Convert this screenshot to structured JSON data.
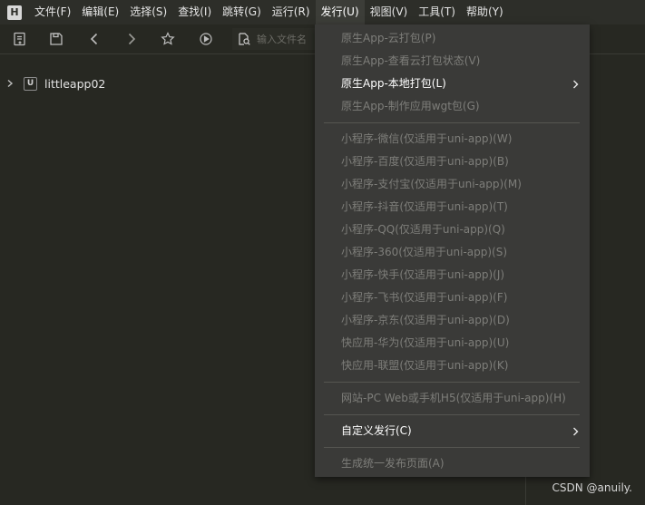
{
  "menubar": {
    "logo": "H",
    "items": [
      "文件(F)",
      "编辑(E)",
      "选择(S)",
      "查找(I)",
      "跳转(G)",
      "运行(R)",
      "发行(U)",
      "视图(V)",
      "工具(T)",
      "帮助(Y)"
    ],
    "active_index": 6
  },
  "toolbar": {
    "icons": [
      "new-file-icon",
      "save-icon",
      "back-icon",
      "forward-icon",
      "favorite-star-icon",
      "run-icon",
      "preview-icon"
    ],
    "search_placeholder": "输入文件名"
  },
  "project_tree": {
    "icon_letter": "U",
    "label": "littleapp02"
  },
  "dropdown": {
    "group1": [
      {
        "label": "原生App-云打包(P)",
        "enabled": false
      },
      {
        "label": "原生App-查看云打包状态(V)",
        "enabled": false
      },
      {
        "label": "原生App-本地打包(L)",
        "enabled": true,
        "submenu": true
      },
      {
        "label": "原生App-制作应用wgt包(G)",
        "enabled": false
      }
    ],
    "group2": [
      {
        "label": "小程序-微信(仅适用于uni-app)(W)",
        "enabled": false
      },
      {
        "label": "小程序-百度(仅适用于uni-app)(B)",
        "enabled": false
      },
      {
        "label": "小程序-支付宝(仅适用于uni-app)(M)",
        "enabled": false
      },
      {
        "label": "小程序-抖音(仅适用于uni-app)(T)",
        "enabled": false
      },
      {
        "label": "小程序-QQ(仅适用于uni-app)(Q)",
        "enabled": false
      },
      {
        "label": "小程序-360(仅适用于uni-app)(S)",
        "enabled": false
      },
      {
        "label": "小程序-快手(仅适用于uni-app)(J)",
        "enabled": false
      },
      {
        "label": "小程序-飞书(仅适用于uni-app)(F)",
        "enabled": false
      },
      {
        "label": "小程序-京东(仅适用于uni-app)(D)",
        "enabled": false
      },
      {
        "label": "快应用-华为(仅适用于uni-app)(U)",
        "enabled": false
      },
      {
        "label": "快应用-联盟(仅适用于uni-app)(K)",
        "enabled": false
      }
    ],
    "group3": [
      {
        "label": "网站-PC Web或手机H5(仅适用于uni-app)(H)",
        "enabled": false
      }
    ],
    "group4": [
      {
        "label": "自定义发行(C)",
        "enabled": true,
        "submenu": true
      }
    ],
    "group5": [
      {
        "label": "生成统一发布页面(A)",
        "enabled": false
      }
    ]
  },
  "watermark": "CSDN @anuily.",
  "colors": {
    "background": "#272822",
    "menubar": "#2d2e29",
    "dropdown": "#3a3a38",
    "enabled_text": "#ffffff",
    "disabled_text": "#7e7e7a"
  }
}
